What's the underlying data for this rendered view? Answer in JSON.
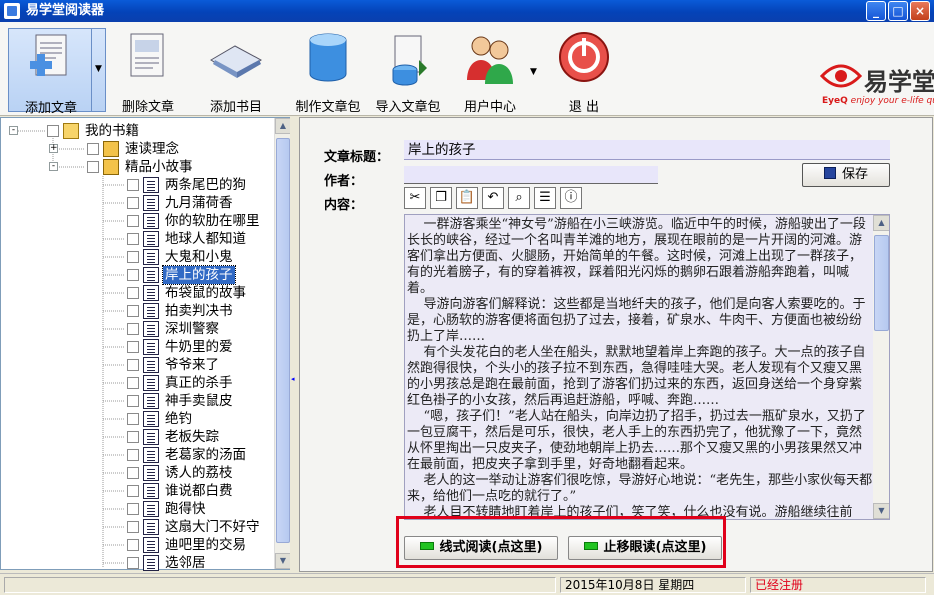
{
  "window": {
    "title": "易学堂阅读器",
    "min_label": "_",
    "max_label": "□",
    "close_label": "×"
  },
  "toolbar": {
    "add_article": "添加文章",
    "delete_article": "删除文章",
    "add_catalog": "添加书目",
    "make_package": "制作文章包",
    "import_package": "导入文章包",
    "user_center": "用户中心",
    "exit": "退  出",
    "dropdown_glyph": "▼"
  },
  "logo": {
    "name": "易学堂",
    "brand": "EyeQ",
    "slogan": "enjoy your e-life quickly",
    "color": "#d91a1a"
  },
  "tree": {
    "root": "我的书籍",
    "folders": [
      {
        "label": "速读理念",
        "expander": "+"
      },
      {
        "label": "精品小故事",
        "expander": "-"
      }
    ],
    "items": [
      "两条尾巴的狗",
      "九月蒲荷香",
      "你的软肋在哪里",
      "地球人都知道",
      "大鬼和小鬼",
      "岸上的孩子",
      "布袋鼠的故事",
      "拍卖判决书",
      "深圳警察",
      "牛奶里的爱",
      "爷爷来了",
      "真正的杀手",
      "神手卖鼠皮",
      "绝钓",
      "老板失踪",
      "老葛家的汤面",
      "诱人的荔枝",
      "谁说都白费",
      "跑得快",
      "这扇大门不好守",
      "迪吧里的交易",
      "选邻居"
    ],
    "selected_index": 5,
    "root_expander": "-"
  },
  "editor": {
    "title_label": "文章标题：",
    "title_value": "岸上的孩子",
    "author_label": "作者：",
    "author_value": "",
    "content_label": "内容：",
    "save_label": "保存",
    "content_text": "    一群游客乘坐“神女号”游船在小三峡游览。临近中午的时候，游船驶出了一段长长的峡谷，经过一个名叫青羊滩的地方，展现在眼前的是一片开阔的河滩。游客们拿出方便面、火腿肠，开始简单的午餐。这时候，河滩上出现了一群孩子，有的光着膀子，有的穿着裤衩，踩着阳光闪烁的鹅卵石跟着游船奔跑着，叫喊着。\n    导游向游客们解释说：这些都是当地纤夫的孩子，他们是向客人索要吃的。于是，心肠软的游客便将面包扔了过去，接着，矿泉水、牛肉干、方便面也被纷纷扔上了岸……\n    有个头发花白的老人坐在船头，默默地望着岸上奔跑的孩子。大一点的孩子自然跑得很快，个头小的孩子拉不到东西，急得哇哇大哭。老人发现有个又瘦又黑的小男孩总是跑在最前面，抢到了游客们扔过来的东西，返回身送给一个身穿紫红色褂子的小女孩，然后再追赶游船，呼喊、奔跑……\n    “嗯，孩子们！”老人站在船头，向岸边扔了招手，扔过去一瓶矿泉水，又扔了一包豆腐干，然后是可乐，很快，老人手上的东西扔完了，他犹豫了一下，竟然从怀里掏出一只皮夹子，使劲地朝岸上扔去……那个又瘦又黑的小男孩果然又冲在最前面，把皮夹子拿到手里，好奇地翻看起来。\n    老人的这一举动让游客们很吃惊，导游好心地说：“老先生，那些小家伙每天都来，给他们一点吃的就行了。”\n    老人目不转睛地盯着岸上的孩子们，笑了笑，什么也没有说。游船继续往前开，过了一会儿，停靠在一个名叫白鹤镇的地方，导游动员大家上岸购买土特产，时间是一个小时。游客们都去买东西了，只有老人没有去，他默默"
  },
  "edit_tools": [
    {
      "name": "cut-icon",
      "glyph": "✂"
    },
    {
      "name": "copy-icon",
      "glyph": "❐"
    },
    {
      "name": "paste-icon",
      "glyph": "📋"
    },
    {
      "name": "undo-icon",
      "glyph": "↶"
    },
    {
      "name": "find-icon",
      "glyph": "⌕"
    },
    {
      "name": "align-icon",
      "glyph": "☰"
    },
    {
      "name": "info-icon",
      "glyph": "ⓘ"
    }
  ],
  "read_buttons": {
    "line_read": "线式阅读(点这里)",
    "stop_read": "止移眼读(点这里)"
  },
  "status": {
    "date": "2015年10月8日  星期四",
    "registered": "已经注册",
    "registered_color": "#e0001a"
  }
}
